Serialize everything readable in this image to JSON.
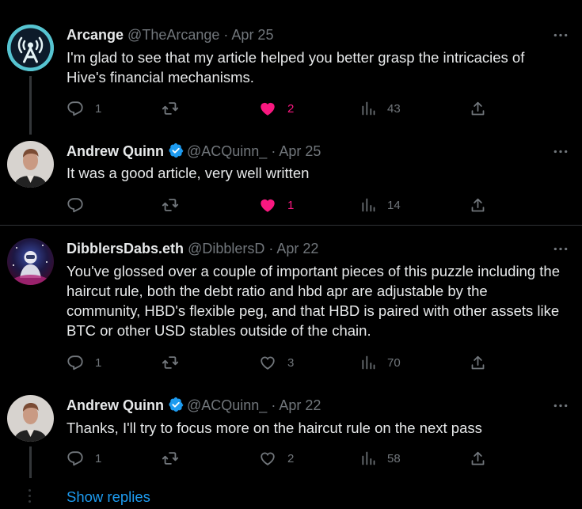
{
  "colors": {
    "background": "#000000",
    "text": "#e7e9ea",
    "muted": "#71767b",
    "like": "#f91880",
    "link": "#1d9bf0",
    "verified": "#1d9bf0"
  },
  "tweets": [
    {
      "name": "Arcange",
      "handle": "@TheArcange",
      "dot": "·",
      "date": "Apr 25",
      "verified": false,
      "text": "I'm glad to see that my article helped you better grasp the intricacies of Hive's financial mechanisms.",
      "replies": "1",
      "retweets": "",
      "likes": "2",
      "liked": true,
      "views": "43"
    },
    {
      "name": "Andrew Quinn",
      "handle": "@ACQuinn_",
      "dot": "·",
      "date": "Apr 25",
      "verified": true,
      "text": "It was a good article, very well written",
      "replies": "",
      "retweets": "",
      "likes": "1",
      "liked": true,
      "views": "14"
    },
    {
      "name": "DibblersDabs.eth",
      "handle": "@DibblersD",
      "dot": "·",
      "date": "Apr 22",
      "verified": false,
      "text": "You've glossed over a couple of important pieces of this puzzle including the haircut rule, both the debt ratio and hbd apr are adjustable by the community, HBD's flexible peg, and that HBD is paired with other assets like BTC or other USD stables outside of the chain.",
      "replies": "1",
      "retweets": "",
      "likes": "3",
      "liked": false,
      "views": "70"
    },
    {
      "name": "Andrew Quinn",
      "handle": "@ACQuinn_",
      "dot": "·",
      "date": "Apr 22",
      "verified": true,
      "text": "Thanks, I'll try to focus more on the haircut rule on the next pass",
      "replies": "1",
      "retweets": "",
      "likes": "2",
      "liked": false,
      "views": "58"
    }
  ],
  "show_replies": "Show replies",
  "icons": [
    "avatar-hive-logo",
    "avatar-portrait",
    "avatar-space-art",
    "verified-badge-icon",
    "more-icon",
    "reply-icon",
    "retweet-icon",
    "like-icon",
    "views-icon",
    "share-icon"
  ]
}
